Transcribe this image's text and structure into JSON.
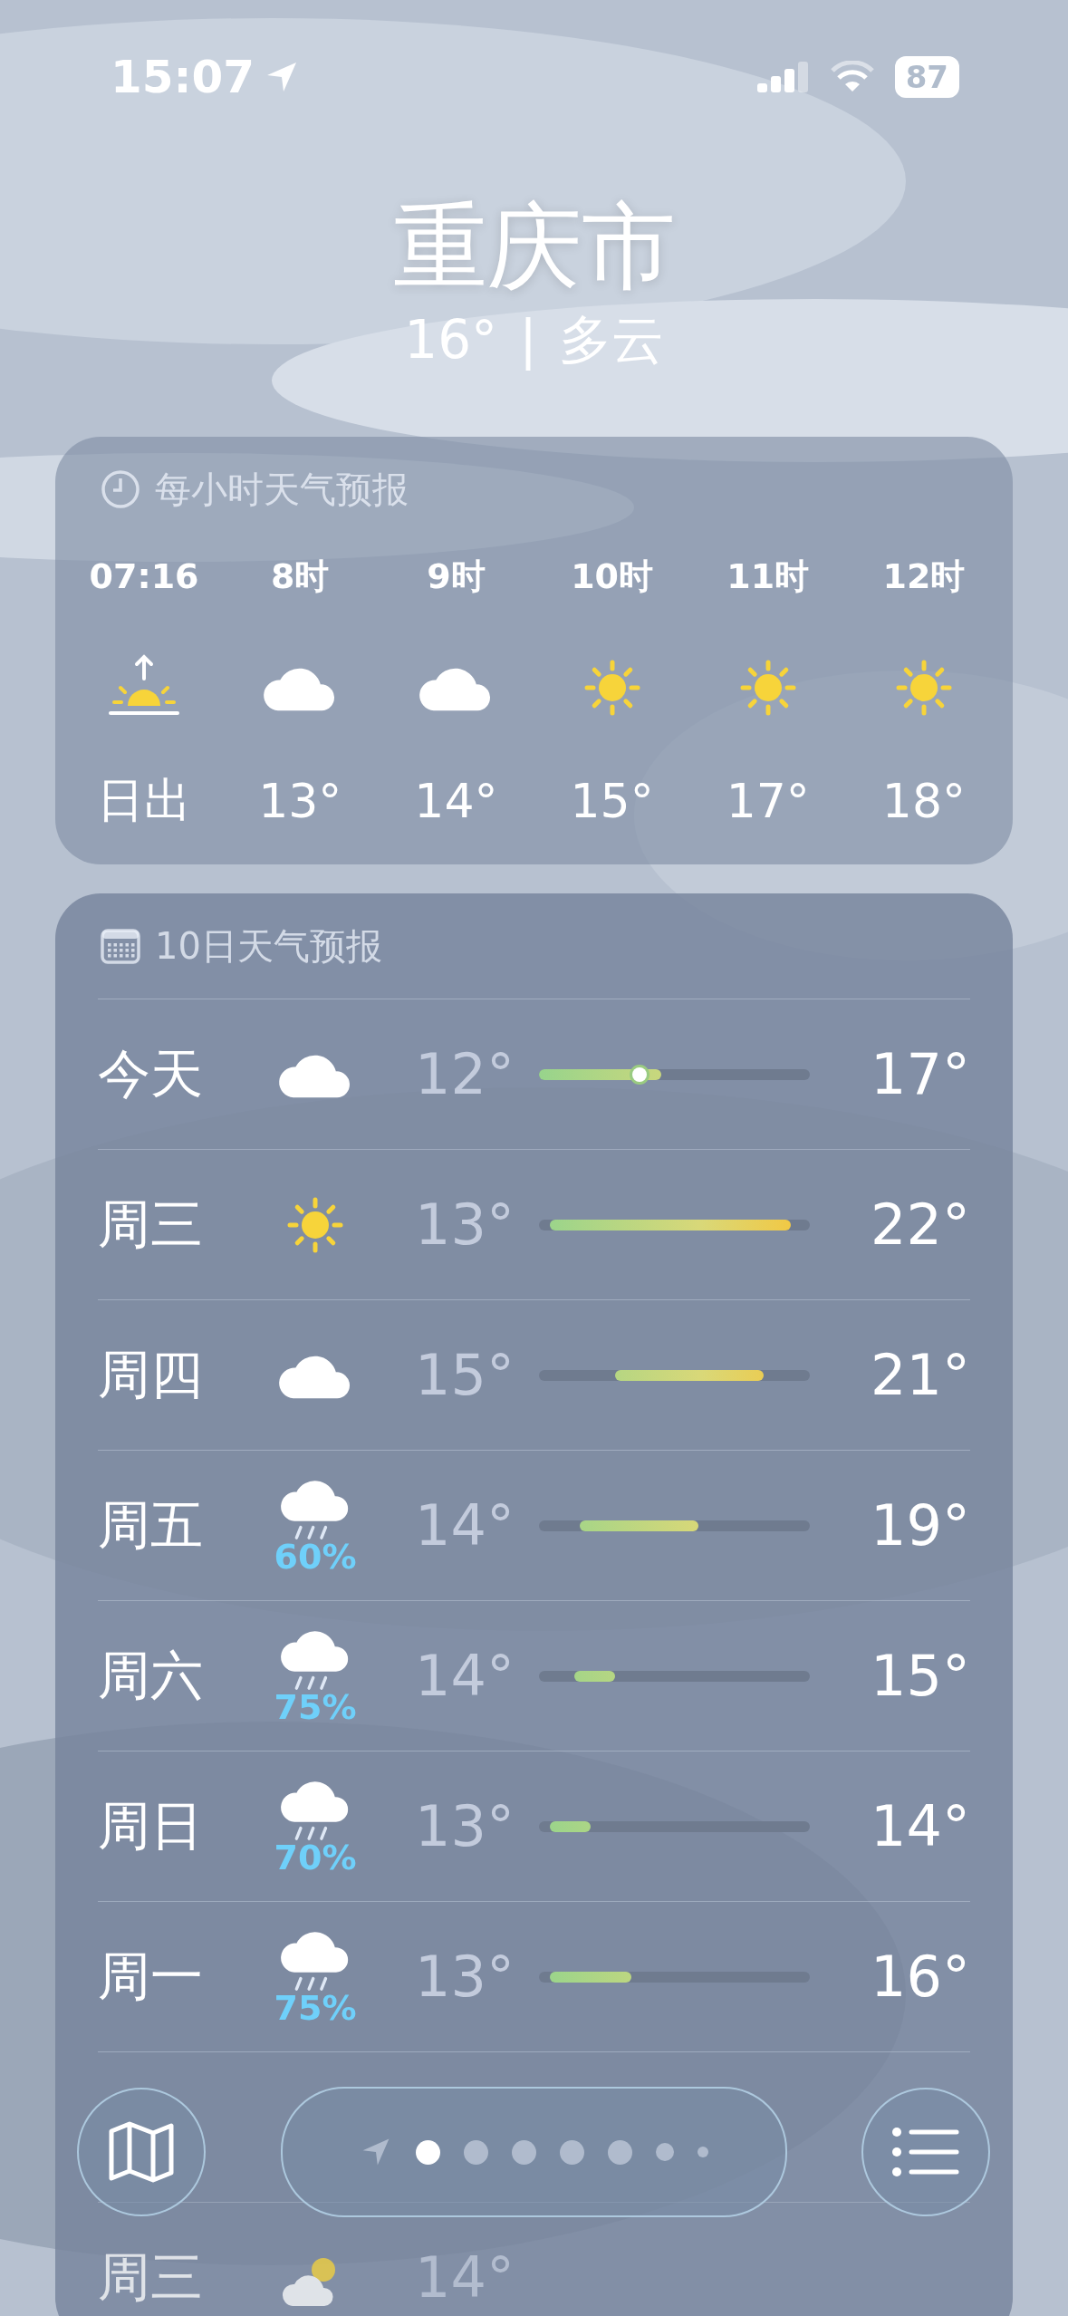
{
  "status_bar": {
    "time": "15:07",
    "battery": "87"
  },
  "location": {
    "city": "重庆市",
    "temperature": "16°",
    "separator": "|",
    "condition": "多云"
  },
  "hourly": {
    "title": "每小时天气预报",
    "items": [
      {
        "time": "07:16",
        "kind": "sunrise",
        "temp": "日出"
      },
      {
        "time": "8时",
        "kind": "cloud",
        "temp": "13°"
      },
      {
        "time": "9时",
        "kind": "cloud",
        "temp": "14°"
      },
      {
        "time": "10时",
        "kind": "sun",
        "temp": "15°"
      },
      {
        "time": "11时",
        "kind": "sun",
        "temp": "17°"
      },
      {
        "time": "12时",
        "kind": "sun",
        "temp": "18°"
      }
    ]
  },
  "daily": {
    "title": "10日天气预报",
    "days": [
      {
        "day": "今天",
        "kind": "cloud",
        "low": "12°",
        "high": "17°",
        "dimmed": false,
        "now": {
          "level": 0.37
        }
      },
      {
        "day": "周三",
        "kind": "sun",
        "low": "13°",
        "high": "22°",
        "dimmed": false
      },
      {
        "day": "周四",
        "kind": "cloud",
        "low": "15°",
        "high": "21°",
        "dimmed": false
      },
      {
        "day": "周五",
        "kind": "rain",
        "precip": "60%",
        "low": "14°",
        "high": "19°",
        "dimmed": false
      },
      {
        "day": "周六",
        "kind": "rain",
        "precip": "75%",
        "low": "14°",
        "high": "15°",
        "dimmed": false
      },
      {
        "day": "周日",
        "kind": "rain",
        "precip": "70%",
        "low": "13°",
        "high": "14°",
        "dimmed": false
      },
      {
        "day": "周一",
        "kind": "rain",
        "precip": "75%",
        "low": "13°",
        "high": "16°",
        "dimmed": false
      },
      {
        "day": "周三",
        "kind": "partly",
        "low": "14°",
        "dimmed": true
      }
    ]
  },
  "page_dots": [
    {
      "kind": "location",
      "selected": false
    },
    {
      "kind": "dot",
      "selected": true
    },
    {
      "kind": "dot",
      "selected": false
    },
    {
      "kind": "dot",
      "selected": false
    },
    {
      "kind": "dot",
      "selected": false
    },
    {
      "kind": "dot",
      "selected": false
    },
    {
      "kind": "small",
      "selected": false
    },
    {
      "kind": "tiny",
      "selected": false
    }
  ]
}
